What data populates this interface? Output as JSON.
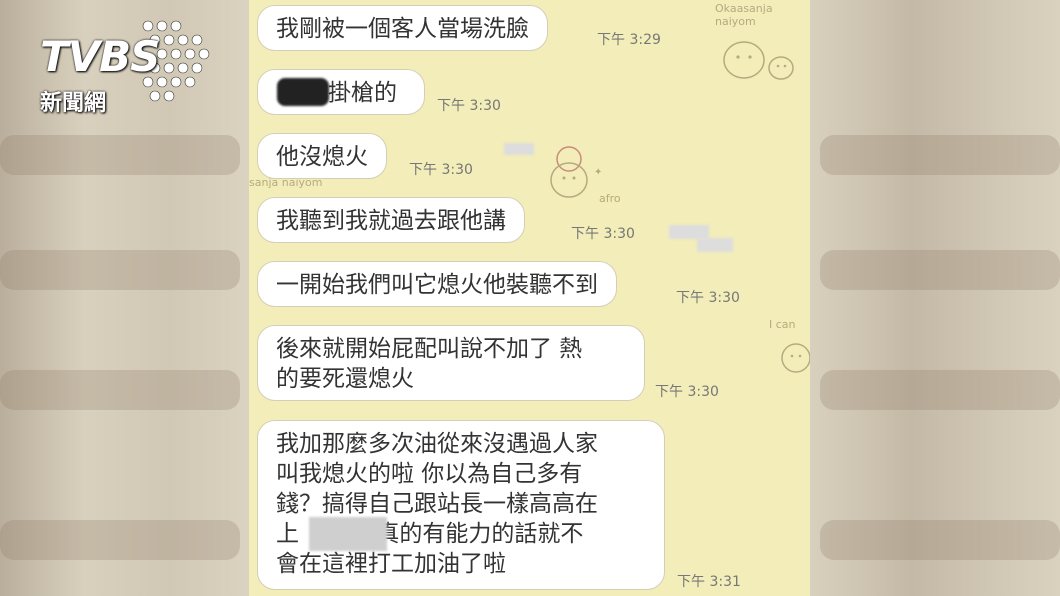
{
  "brand": {
    "logo": "TVBS",
    "subtitle": "新聞網"
  },
  "messages": [
    {
      "text": "我剛被一個客人當場洗臉",
      "time": "下午 3:29"
    },
    {
      "text": "掛槍的",
      "time": "下午 3:30"
    },
    {
      "text": "他沒熄火",
      "time": "下午 3:30"
    },
    {
      "text": "我聽到我就過去跟他講",
      "time": "下午 3:30"
    },
    {
      "text": "一開始我們叫它熄火他裝聽不到",
      "time": "下午 3:30"
    },
    {
      "text": "後來就開始屁配叫說不加了 熱\n的要死還熄火",
      "time": "下午 3:30"
    },
    {
      "text": "我加那麼多次油從來沒遇過人家\n叫我熄火的啦 你以為自己多有\n錢？搞得自己跟站長一樣高高在\n上 ",
      "text_after": "真的有能力的話就不\n會在這裡打工加油了啦",
      "time": "下午 3:31"
    }
  ],
  "decor": {
    "sticker_text_1": "Okaasanja naiyom",
    "sticker_text_2": "afro",
    "sticker_text_3": "I can",
    "sticker_text_4": "sanja naiyom"
  },
  "colors": {
    "chat_bg": "#f3edb9",
    "bubble_bg": "#ffffff",
    "bubble_border": "#d4ceb8"
  }
}
